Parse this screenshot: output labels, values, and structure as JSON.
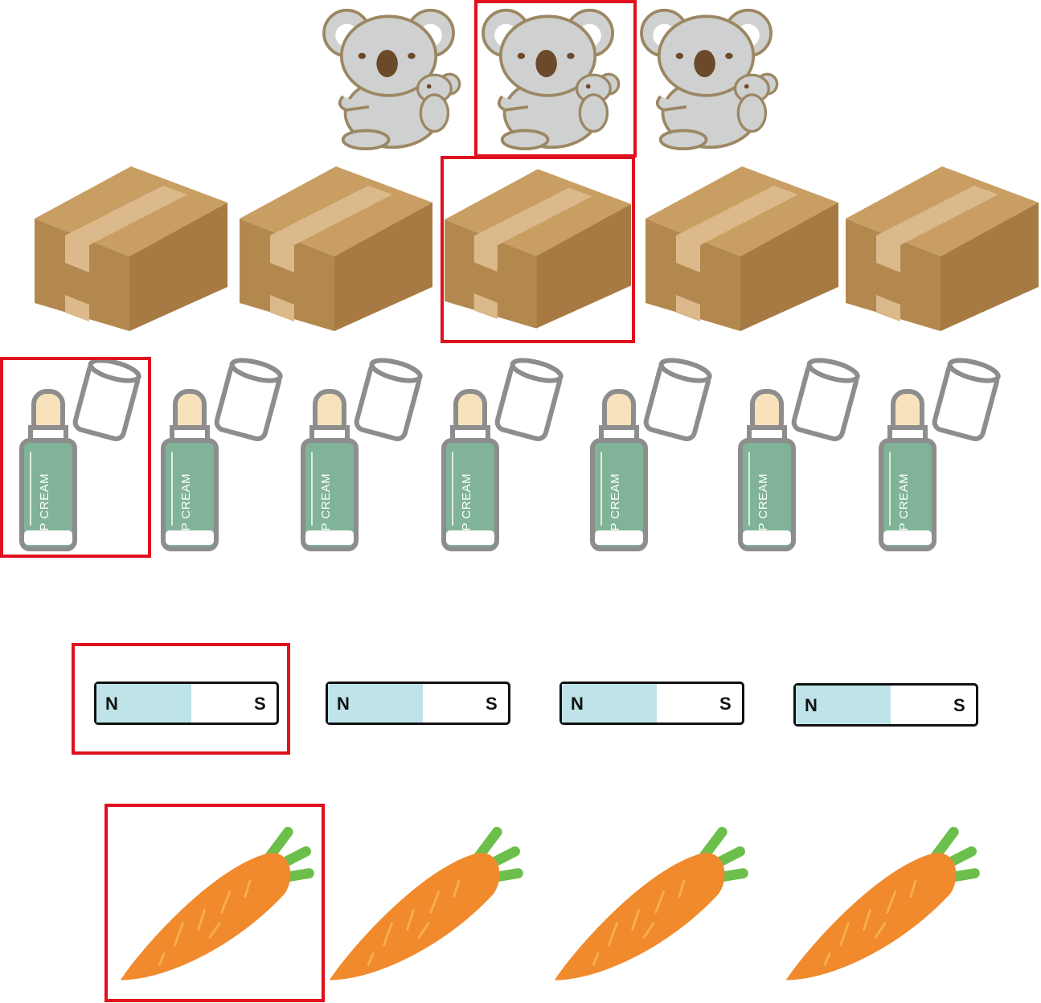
{
  "rows": [
    {
      "item": "koala",
      "count": 3,
      "highlighted_index": 1
    },
    {
      "item": "cardboard-box",
      "count": 5,
      "highlighted_index": 2
    },
    {
      "item": "lip-cream",
      "count": 7,
      "highlighted_index": 0,
      "label": "LIP CREAM"
    },
    {
      "item": "magnet",
      "count": 4,
      "highlighted_index": 0,
      "north_label": "N",
      "south_label": "S"
    },
    {
      "item": "carrot",
      "count": 4,
      "highlighted_index": 0
    }
  ],
  "colors": {
    "highlight": "#e0101e",
    "koala_fur": "#cfd1d1",
    "koala_outline": "#9c8763",
    "koala_nose": "#6b4a2a",
    "box_top": "#c89e63",
    "box_front": "#b3884f",
    "box_side": "#a77a44",
    "box_tape": "#dbb98a",
    "lip_body": "#80b398",
    "lip_cap_tip": "#f7e2bc",
    "magnet_north": "#bee3e9",
    "carrot_body": "#f08a2c",
    "carrot_leaf": "#6cbf4a"
  }
}
